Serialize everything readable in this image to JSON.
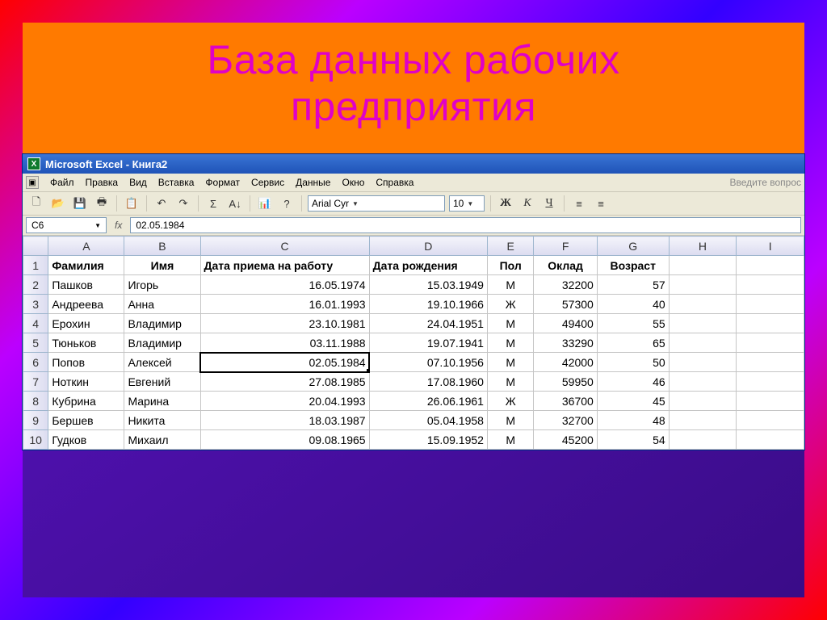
{
  "slide": {
    "title_line1": "База данных рабочих",
    "title_line2": "предприятия"
  },
  "window": {
    "title": "Microsoft Excel - Книга2",
    "ask_question": "Введите вопрос"
  },
  "menu": {
    "file": "Файл",
    "edit": "Правка",
    "view": "Вид",
    "insert": "Вставка",
    "format": "Формат",
    "tools": "Сервис",
    "data": "Данные",
    "window": "Окно",
    "help": "Справка"
  },
  "toolbar": {
    "font_name": "Arial Cyr",
    "font_size": "10",
    "bold": "Ж",
    "italic": "К",
    "underline": "Ч"
  },
  "formula_bar": {
    "cell_ref": "C6",
    "content": "02.05.1984"
  },
  "grid": {
    "col_letters": [
      "A",
      "B",
      "C",
      "D",
      "E",
      "F",
      "G",
      "H",
      "I"
    ],
    "headers": [
      "Фамилия",
      "Имя",
      "Дата приема на работу",
      "Дата рождения",
      "Пол",
      "Оклад",
      "Возраст",
      "",
      ""
    ],
    "rows": [
      {
        "n": "2",
        "cells": [
          "Пашков",
          "Игорь",
          "16.05.1974",
          "15.03.1949",
          "М",
          "32200",
          "57",
          "",
          ""
        ]
      },
      {
        "n": "3",
        "cells": [
          "Андреева",
          "Анна",
          "16.01.1993",
          "19.10.1966",
          "Ж",
          "57300",
          "40",
          "",
          ""
        ]
      },
      {
        "n": "4",
        "cells": [
          "Ерохин",
          "Владимир",
          "23.10.1981",
          "24.04.1951",
          "М",
          "49400",
          "55",
          "",
          ""
        ]
      },
      {
        "n": "5",
        "cells": [
          "Тюньков",
          "Владимир",
          "03.11.1988",
          "19.07.1941",
          "М",
          "33290",
          "65",
          "",
          ""
        ]
      },
      {
        "n": "6",
        "cells": [
          "Попов",
          "Алексей",
          "02.05.1984",
          "07.10.1956",
          "М",
          "42000",
          "50",
          "",
          ""
        ]
      },
      {
        "n": "7",
        "cells": [
          "Ноткин",
          "Евгений",
          "27.08.1985",
          "17.08.1960",
          "М",
          "59950",
          "46",
          "",
          ""
        ]
      },
      {
        "n": "8",
        "cells": [
          "Кубрина",
          "Марина",
          "20.04.1993",
          "26.06.1961",
          "Ж",
          "36700",
          "45",
          "",
          ""
        ]
      },
      {
        "n": "9",
        "cells": [
          "Бершев",
          "Никита",
          "18.03.1987",
          "05.04.1958",
          "М",
          "32700",
          "48",
          "",
          ""
        ]
      },
      {
        "n": "10",
        "cells": [
          "Гудков",
          "Михаил",
          "09.08.1965",
          "15.09.1952",
          "М",
          "45200",
          "54",
          "",
          ""
        ]
      }
    ],
    "active": {
      "row": "6",
      "col": 2
    }
  },
  "icons": {
    "new": "🗋",
    "open": "📂",
    "save": "💾",
    "print": "🖶",
    "sigma": "Σ",
    "sort": "A↓",
    "chart": "📊",
    "help": "?"
  }
}
